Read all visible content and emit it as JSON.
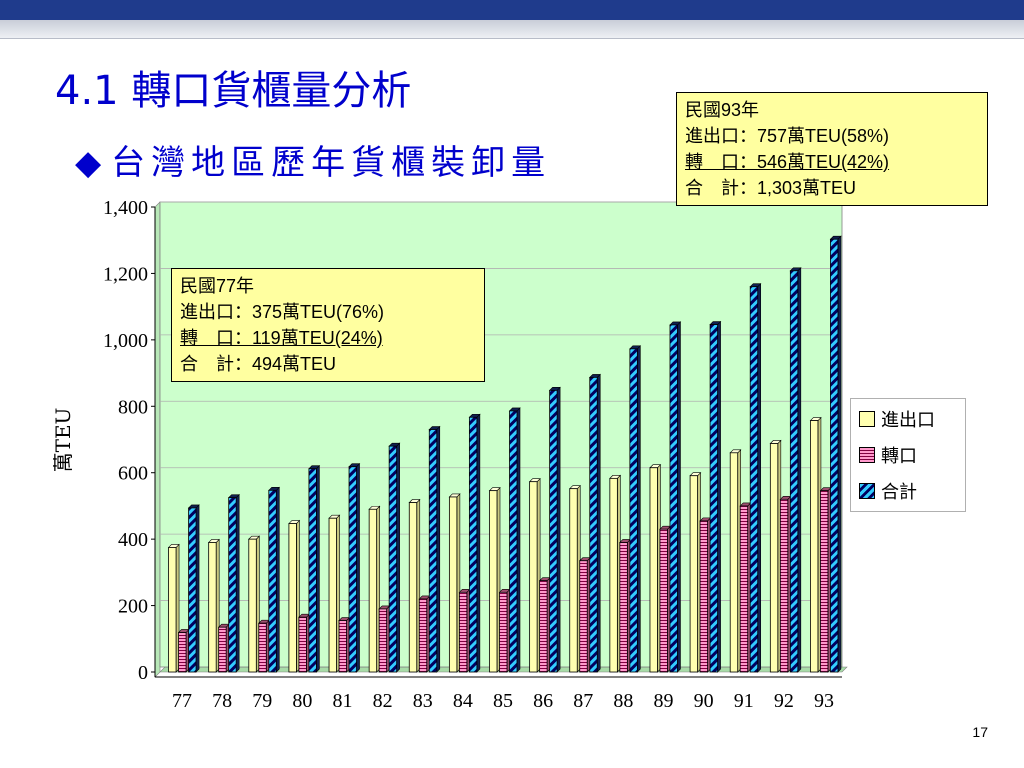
{
  "slide": {
    "title": "4.1 轉口貨櫃量分析",
    "subtitle_marker": "◆",
    "subtitle": "台灣地區歷年貨櫃裝卸量",
    "page_number": "17"
  },
  "callouts": {
    "y77": {
      "line1": "民國77年",
      "line2": "進出口：375萬TEU(76%)",
      "line3": "轉　口：119萬TEU(24%)",
      "line4": "合　計：494萬TEU"
    },
    "y93": {
      "line1": "民國93年",
      "line2": "進出口：757萬TEU(58%)",
      "line3": "轉　口：546萬TEU(42%)",
      "line4": "合　計：1,303萬TEU"
    }
  },
  "colors": {
    "export_fill": "#ffffb0",
    "transship_fill": "#ff99cc",
    "transship_stripe": "#800040",
    "total_fill": "#33ccff",
    "total_stripe": "#000060",
    "plot_background": "#ccffcc",
    "title_color": "#0000cc"
  },
  "chart_data": {
    "type": "bar",
    "title": "",
    "xlabel": "",
    "ylabel": "萬TEU",
    "ylim": [
      0,
      1400
    ],
    "yticks": [
      0,
      200,
      400,
      600,
      800,
      1000,
      1200,
      1400
    ],
    "ytick_labels": [
      "0",
      "200",
      "400",
      "600",
      "800",
      "1,000",
      "1,200",
      "1,400"
    ],
    "grid": true,
    "legend_position": "right",
    "categories": [
      "77",
      "78",
      "79",
      "80",
      "81",
      "82",
      "83",
      "84",
      "85",
      "86",
      "87",
      "88",
      "89",
      "90",
      "91",
      "92",
      "93"
    ],
    "series": [
      {
        "name": "進出口",
        "values": [
          375,
          390,
          400,
          447,
          463,
          490,
          510,
          527,
          546,
          573,
          552,
          583,
          615,
          591,
          660,
          688,
          757
        ]
      },
      {
        "name": "轉口",
        "values": [
          119,
          135,
          147,
          165,
          155,
          190,
          220,
          240,
          240,
          275,
          335,
          390,
          430,
          455,
          500,
          520,
          546
        ]
      },
      {
        "name": "合計",
        "values": [
          494,
          525,
          547,
          612,
          618,
          680,
          730,
          767,
          786,
          848,
          887,
          973,
          1045,
          1046,
          1160,
          1208,
          1303
        ]
      }
    ]
  }
}
